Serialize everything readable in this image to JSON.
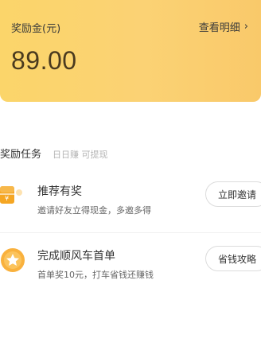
{
  "reward_card": {
    "label": "奖励金(元)",
    "details_link": "查看明细",
    "chevron": "›",
    "balance": "89.00"
  },
  "section": {
    "title": "奖励任务",
    "subtitle": "日日赚 可提现"
  },
  "tasks": [
    {
      "title": "推荐有奖",
      "desc": "邀请好友立得现金，多邀多得",
      "button": "立即邀请",
      "icon": "gift-icon"
    },
    {
      "title": "完成顺风车首单",
      "desc": "首单奖10元，打车省钱还赚钱",
      "button": "省钱攻略",
      "icon": "star-badge-icon"
    }
  ],
  "colors": {
    "card_gradient_start": "#fbd56a",
    "card_gradient_end": "#f9c96a",
    "icon_orange": "#f5a623"
  }
}
